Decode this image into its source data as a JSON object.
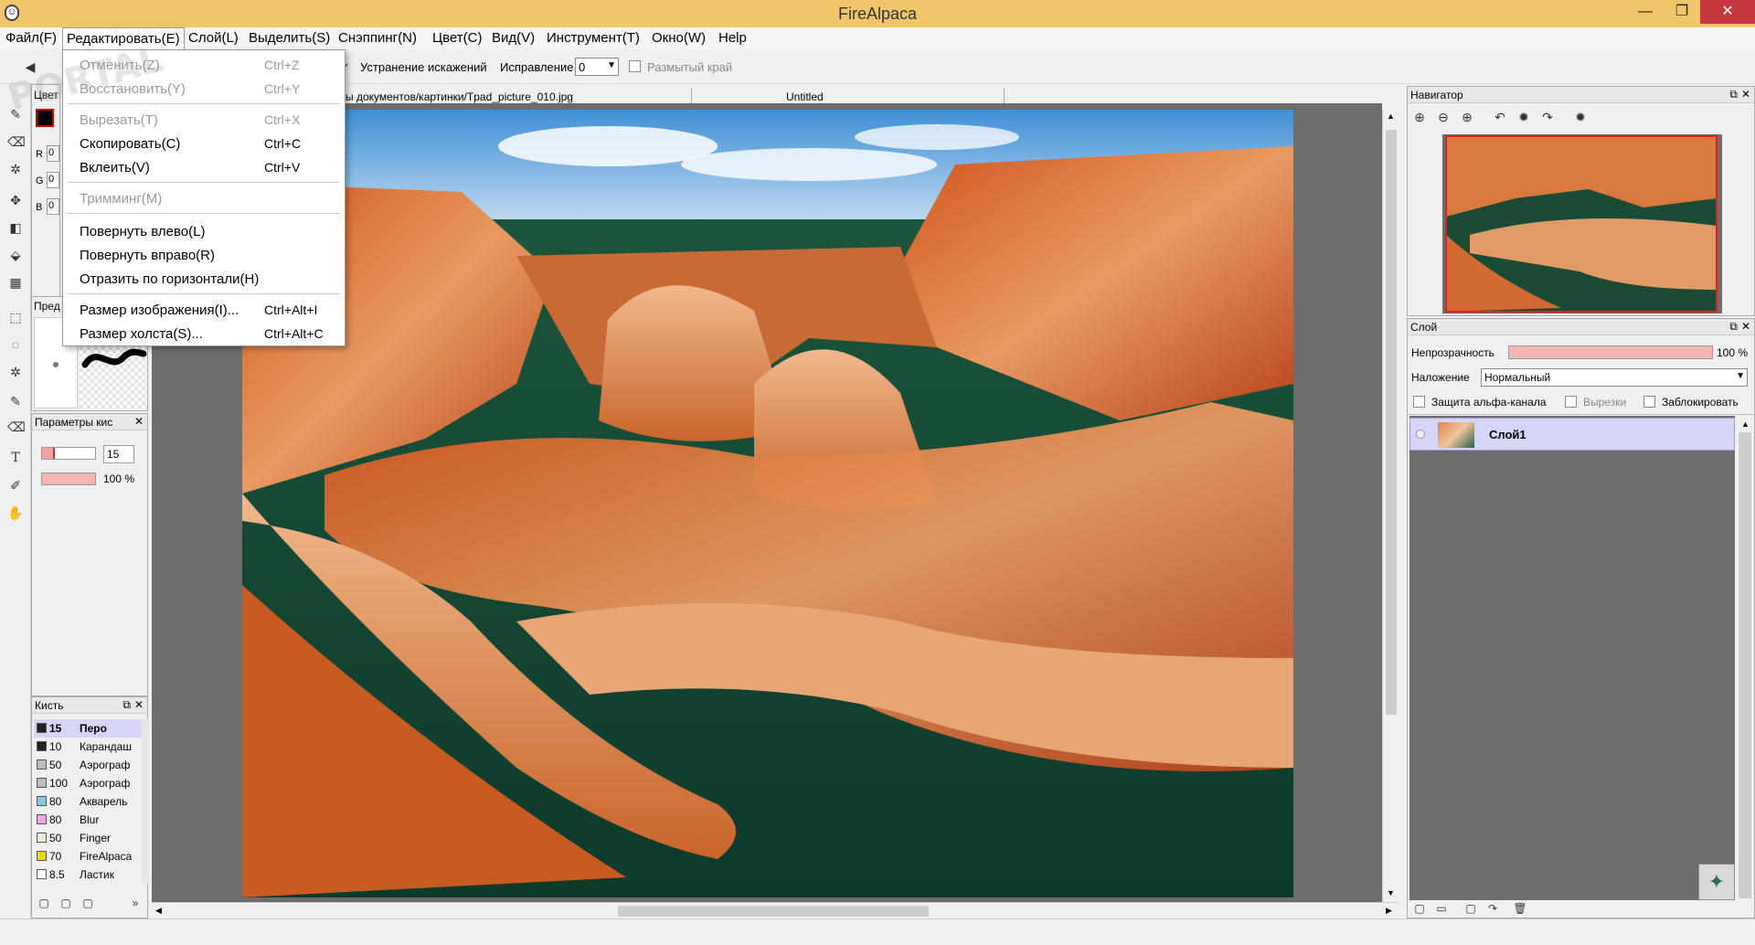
{
  "window": {
    "title": "FireAlpaca",
    "app_icon_glyph": "☺",
    "minimize_glyph": "—",
    "maximize_glyph": "❐",
    "close_glyph": "✕"
  },
  "menubar": {
    "items": [
      "Файл(F)",
      "Редактировать(E)",
      "Слой(L)",
      "Выделить(S)",
      "Снэппинг(N)",
      "Цвет(C)",
      "Вид(V)",
      "Инструмент(T)",
      "Окно(W)",
      "Help"
    ]
  },
  "toolbar": {
    "distortion_label": "Устранение искажений",
    "correction_label": "Исправление",
    "correction_value": "0",
    "blur_edge_label": "Размытый край"
  },
  "edit_menu": {
    "items": [
      {
        "label": "Отменить(Z)",
        "shortcut": "Ctrl+Z",
        "disabled": true
      },
      {
        "label": "Восстановить(Y)",
        "shortcut": "Ctrl+Y",
        "disabled": true
      },
      {
        "label": "Вырезать(T)",
        "shortcut": "Ctrl+X",
        "disabled": true
      },
      {
        "label": "Скопировать(C)",
        "shortcut": "Ctrl+C",
        "disabled": false
      },
      {
        "label": "Вклеить(V)",
        "shortcut": "Ctrl+V",
        "disabled": false
      },
      {
        "label": "Тримминг(M)",
        "shortcut": "",
        "disabled": true
      },
      {
        "label": "Повернуть влево(L)",
        "shortcut": "",
        "disabled": false
      },
      {
        "label": "Повернуть вправо(R)",
        "shortcut": "",
        "disabled": false
      },
      {
        "label": "Отразить по горизонтали(H)",
        "shortcut": "",
        "disabled": false
      },
      {
        "label": "Размер изображения(I)...",
        "shortcut": "Ctrl+Alt+I",
        "disabled": false
      },
      {
        "label": "Размер холста(S)...",
        "shortcut": "Ctrl+Alt+C",
        "disabled": false
      }
    ],
    "watermark": "PORTAL"
  },
  "color_panel": {
    "title": "Цвет",
    "r_label": "R",
    "g_label": "G",
    "b_label": "B",
    "r_value": "0",
    "g_value": "0",
    "b_value": "0"
  },
  "preview_panel": {
    "title": "Пред"
  },
  "brush_params": {
    "title": "Параметры кис",
    "size_value": "15",
    "opacity_value": "100 %"
  },
  "brush_panel": {
    "title": "Кисть",
    "rows": [
      {
        "size": "15",
        "name": "Перо",
        "color": "#222222",
        "selected": true
      },
      {
        "size": "10",
        "name": "Карандаш",
        "color": "#222222",
        "selected": false
      },
      {
        "size": "50",
        "name": "Аэрограф",
        "color": "#bbbbbb",
        "selected": false
      },
      {
        "size": "100",
        "name": "Аэрограф",
        "color": "#bbbbbb",
        "selected": false
      },
      {
        "size": "80",
        "name": "Акварель",
        "color": "#7ec8ee",
        "selected": false
      },
      {
        "size": "80",
        "name": "Blur",
        "color": "#f4a6e6",
        "selected": false
      },
      {
        "size": "50",
        "name": "Finger",
        "color": "#f3ead8",
        "selected": false
      },
      {
        "size": "70",
        "name": "FireAlpaca",
        "color": "#e9d61a",
        "selected": false
      },
      {
        "size": "8.5",
        "name": "Ластик",
        "color": "#ffffff",
        "selected": false
      }
    ],
    "more_glyph": "»"
  },
  "document": {
    "tab1": "ы документов/картинки/Тpad_picture_010.jpg",
    "tab2": "Untitled"
  },
  "navigator": {
    "title": "Навигатор"
  },
  "layers": {
    "title": "Слой",
    "opacity_label": "Непрозрачность",
    "opacity_value": "100 %",
    "opacity_fraction": 1.0,
    "blend_label": "Наложение",
    "blend_value": "Нормальный",
    "alpha_protect_label": "Защита альфа-канала",
    "clipping_label": "Вырезки",
    "lock_label": "Заблокировать",
    "layer_name": "Слой1"
  },
  "icons": {
    "pen": "✎",
    "eraser": "⌫",
    "move": "✥",
    "fill": "◧",
    "bucket": "⬙",
    "gradient": "▦",
    "select": "⬚",
    "lasso": "◌",
    "wand": "✲",
    "text": "T",
    "dropper": "✐",
    "hand": "✋",
    "zoom_in": "⊕",
    "zoom_out": "⊖",
    "rotate_left": "↶",
    "rotate_right": "↷",
    "reset": "✹",
    "new": "▢",
    "folder": "▭",
    "trash": "🗑",
    "scroll_up": "▲",
    "scroll_down": "▼",
    "scroll_left": "◀",
    "scroll_right": "▶"
  }
}
